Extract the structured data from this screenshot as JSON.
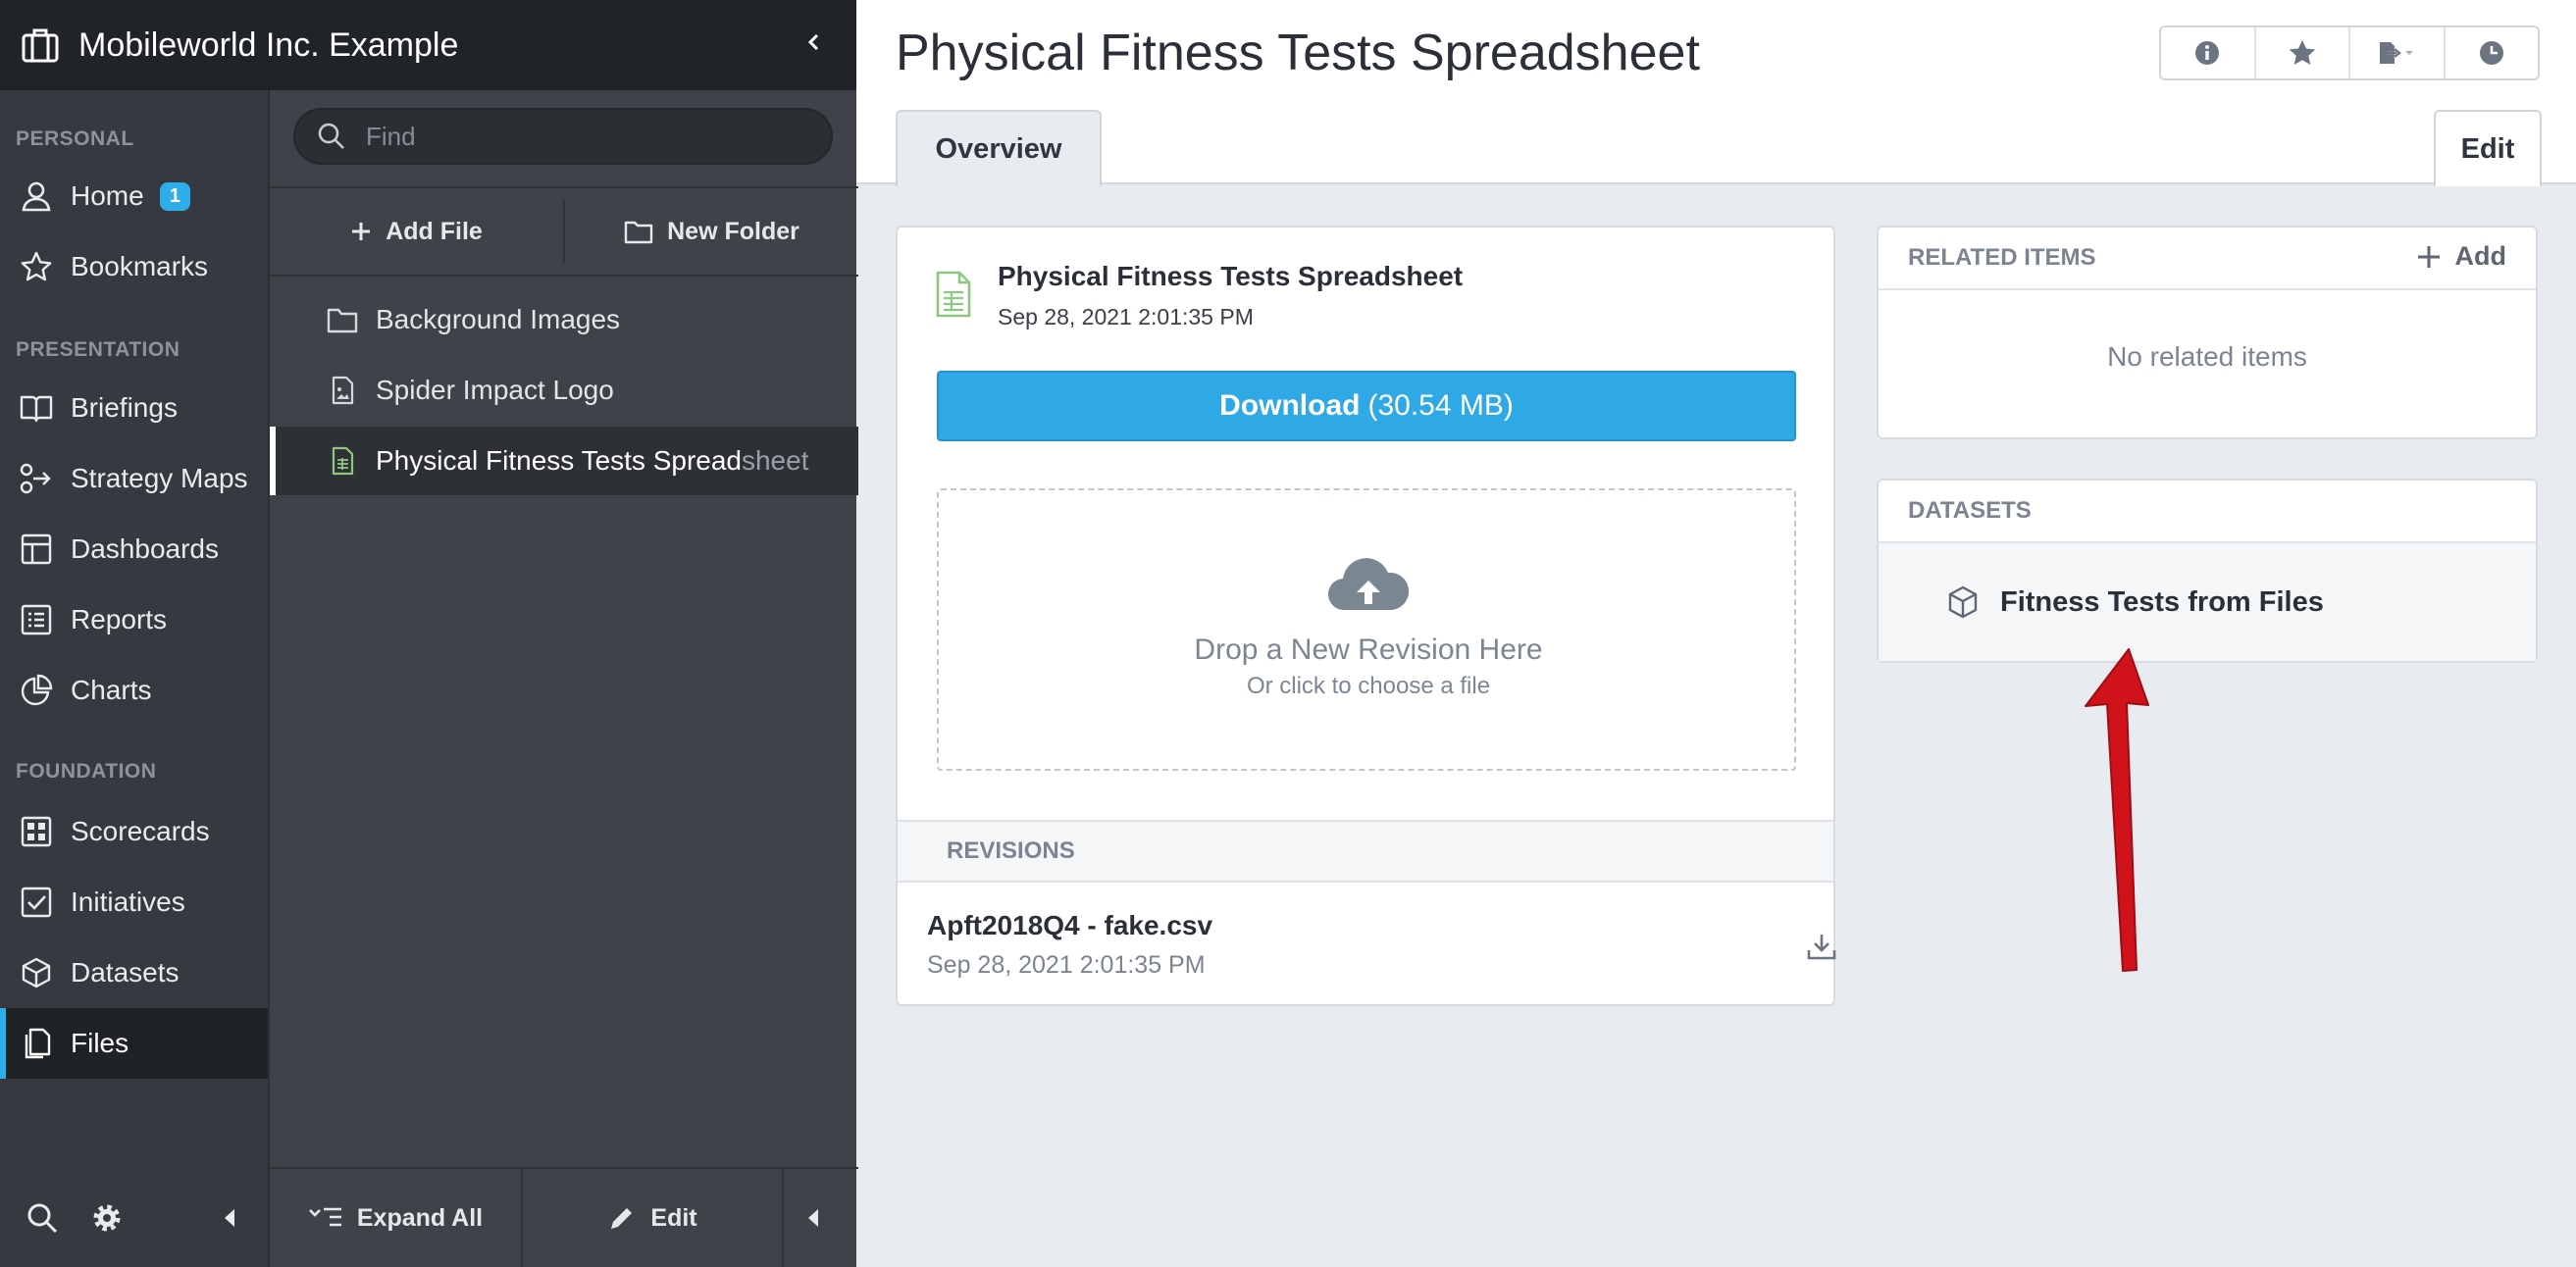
{
  "app": {
    "org_name": "Mobileworld Inc. Example"
  },
  "nav": {
    "sections": {
      "personal": "PERSONAL",
      "presentation": "PRESENTATION",
      "foundation": "FOUNDATION"
    },
    "items": [
      {
        "label": "Home",
        "icon": "user-icon",
        "badge": "1"
      },
      {
        "label": "Bookmarks",
        "icon": "star-icon"
      },
      {
        "label": "Briefings",
        "icon": "book-icon"
      },
      {
        "label": "Strategy Maps",
        "icon": "strategy-map-icon"
      },
      {
        "label": "Dashboards",
        "icon": "dashboard-icon"
      },
      {
        "label": "Reports",
        "icon": "list-icon"
      },
      {
        "label": "Charts",
        "icon": "pie-chart-icon"
      },
      {
        "label": "Scorecards",
        "icon": "scorecard-icon"
      },
      {
        "label": "Initiatives",
        "icon": "checkbox-icon"
      },
      {
        "label": "Datasets",
        "icon": "cube-icon"
      },
      {
        "label": "Files",
        "icon": "files-icon",
        "active": true
      }
    ]
  },
  "file_panel": {
    "search_placeholder": "Find",
    "add_file": "Add File",
    "new_folder": "New Folder",
    "items": [
      {
        "label": "Background Images",
        "icon": "folder-icon"
      },
      {
        "label": "Spider Impact Logo",
        "icon": "image-file-icon"
      },
      {
        "label": "Physical Fitness Tests Spread",
        "label_fade": "sheet",
        "icon": "spreadsheet-icon",
        "active": true
      }
    ],
    "expand_all": "Expand All",
    "edit": "Edit"
  },
  "page": {
    "title": "Physical Fitness Tests Spreadsheet",
    "tab_overview": "Overview",
    "edit_label": "Edit"
  },
  "file_card": {
    "name": "Physical Fitness Tests Spreadsheet",
    "date": "Sep 28, 2021 2:01:35 PM",
    "download_label": "Download",
    "download_size": "(30.54 MB)",
    "drop_title": "Drop a New Revision Here",
    "drop_sub": "Or click to choose a file",
    "revisions_header": "REVISIONS",
    "revision": {
      "name": "Apft2018Q4 - fake.csv",
      "date": "Sep 28, 2021 2:01:35 PM"
    }
  },
  "related": {
    "header": "RELATED ITEMS",
    "add_label": "Add",
    "empty": "No related items"
  },
  "datasets": {
    "header": "DATASETS",
    "item": "Fitness Tests from Files"
  },
  "colors": {
    "accent": "#2eaee8",
    "download": "#2fa8e6",
    "annotation_arrow": "#d0121b"
  }
}
